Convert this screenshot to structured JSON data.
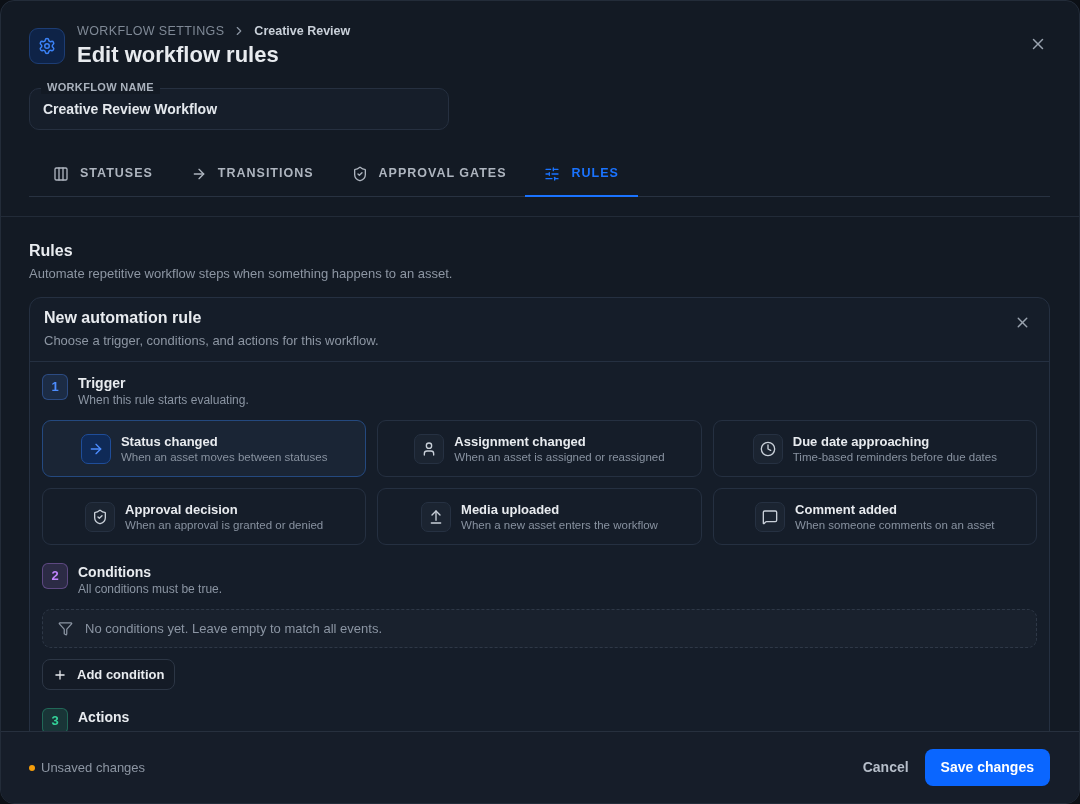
{
  "header": {
    "breadcrumb": [
      "WORKFLOW SETTINGS",
      "Creative Review"
    ],
    "title": "Edit workflow rules"
  },
  "workflow_name": {
    "label": "WORKFLOW NAME",
    "value": "Creative Review Workflow"
  },
  "tabs": [
    {
      "label": "STATUSES",
      "selected": false
    },
    {
      "label": "TRANSITIONS",
      "selected": false
    },
    {
      "label": "APPROVAL GATES",
      "selected": false
    },
    {
      "label": "RULES",
      "selected": true
    }
  ],
  "section": {
    "title": "Rules",
    "description": "Automate repetitive workflow steps when something happens to an asset."
  },
  "rule_card": {
    "title": "New automation rule",
    "description": "Choose a trigger, conditions, and actions for this workflow.",
    "steps": [
      {
        "number": "1",
        "title": "Trigger",
        "description": "When this rule starts evaluating.",
        "color": "#4d8dff",
        "options": [
          {
            "title": "Status changed",
            "description": "When an asset moves between statuses",
            "selected": true
          },
          {
            "title": "Assignment changed",
            "description": "When an asset is assigned or reassigned",
            "selected": false
          },
          {
            "title": "Due date approaching",
            "description": "Time-based reminders before due dates",
            "selected": false
          },
          {
            "title": "Approval decision",
            "description": "When an approval is granted or denied",
            "selected": false
          },
          {
            "title": "Media uploaded",
            "description": "When a new asset enters the workflow",
            "selected": false
          },
          {
            "title": "Comment added",
            "description": "When someone comments on an asset",
            "selected": false
          }
        ]
      },
      {
        "number": "2",
        "title": "Conditions",
        "description": "All conditions must be true.",
        "color": "#c084fc",
        "empty_message": "No conditions yet. Leave empty to match all events.",
        "add_button": "Add condition"
      },
      {
        "number": "3",
        "title": "Actions",
        "color": "#34d399"
      }
    ]
  },
  "footer": {
    "status": "Unsaved changes",
    "buttons": [
      {
        "label": "Cancel",
        "kind": "ghost"
      },
      {
        "label": "Save changes",
        "kind": "primary"
      }
    ]
  }
}
